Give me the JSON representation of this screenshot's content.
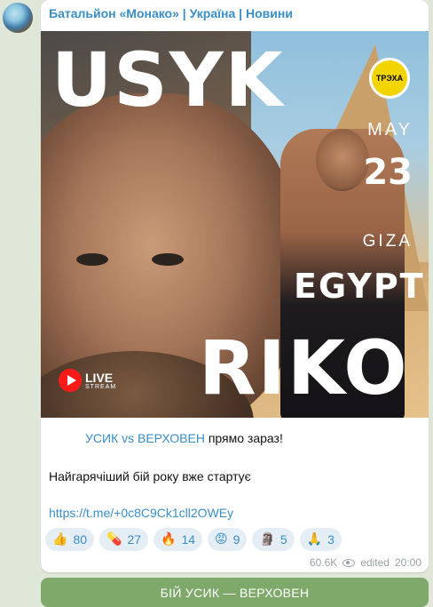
{
  "channel": {
    "name": "Батальйон «Монако» | Україна | Новини"
  },
  "poster": {
    "top_word": "USYK",
    "bottom_word": "RIKO",
    "location_word": "EGYPT",
    "month": "MAY",
    "day": "23",
    "city": "GIZA",
    "logo_text": "ТРЭХА",
    "live_label": "LIVE",
    "stream_label": "STREAM"
  },
  "message": {
    "line1_link": "УСИК vs ВЕРХОВЕН",
    "line1_rest": " прямо зараз!",
    "line2": "Найгарячіший бій року вже стартує",
    "url": "https://t.me/+0c8C9Ck1cll2OWEy"
  },
  "reactions": [
    {
      "emoji": "👍",
      "count": "80"
    },
    {
      "emoji": "💊",
      "count": "27"
    },
    {
      "emoji": "🔥",
      "count": "14"
    },
    {
      "emoji": "😡",
      "count": "9"
    },
    {
      "emoji": "🗿",
      "count": "5"
    },
    {
      "emoji": "🙏",
      "count": "3"
    }
  ],
  "meta": {
    "views": "60.6K",
    "edited": "edited",
    "time": "20:00"
  },
  "button": {
    "label": "БІЙ УСИК — ВЕРХОВЕН"
  }
}
